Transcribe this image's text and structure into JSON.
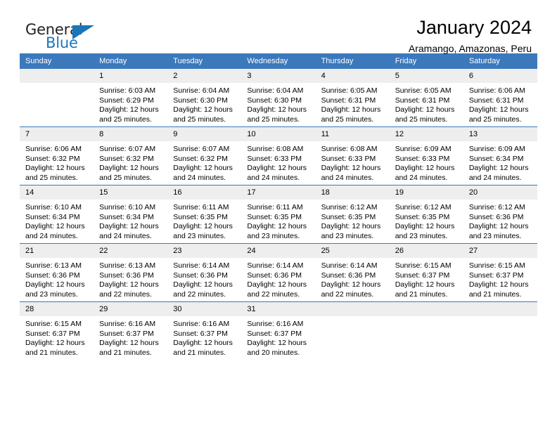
{
  "brand": {
    "name_top": "General",
    "name_bottom": "Blue",
    "triangle_color": "#1b75bb",
    "text_color": "#231f20"
  },
  "header": {
    "title": "January 2024",
    "subtitle": "Aramango, Amazonas, Peru"
  },
  "theme": {
    "header_bg": "#3b79bc",
    "header_text": "#ffffff",
    "daynum_bg": "#eeeeee",
    "cell_bg": "#ffffff",
    "grid_line": "#3b79bc"
  },
  "weekdays": [
    "Sunday",
    "Monday",
    "Tuesday",
    "Wednesday",
    "Thursday",
    "Friday",
    "Saturday"
  ],
  "weeks": [
    [
      {
        "day": "",
        "sunrise": "",
        "sunset": "",
        "daylight_line1": "",
        "daylight_line2": ""
      },
      {
        "day": "1",
        "sunrise": "Sunrise: 6:03 AM",
        "sunset": "Sunset: 6:29 PM",
        "daylight_line1": "Daylight: 12 hours",
        "daylight_line2": "and 25 minutes."
      },
      {
        "day": "2",
        "sunrise": "Sunrise: 6:04 AM",
        "sunset": "Sunset: 6:30 PM",
        "daylight_line1": "Daylight: 12 hours",
        "daylight_line2": "and 25 minutes."
      },
      {
        "day": "3",
        "sunrise": "Sunrise: 6:04 AM",
        "sunset": "Sunset: 6:30 PM",
        "daylight_line1": "Daylight: 12 hours",
        "daylight_line2": "and 25 minutes."
      },
      {
        "day": "4",
        "sunrise": "Sunrise: 6:05 AM",
        "sunset": "Sunset: 6:31 PM",
        "daylight_line1": "Daylight: 12 hours",
        "daylight_line2": "and 25 minutes."
      },
      {
        "day": "5",
        "sunrise": "Sunrise: 6:05 AM",
        "sunset": "Sunset: 6:31 PM",
        "daylight_line1": "Daylight: 12 hours",
        "daylight_line2": "and 25 minutes."
      },
      {
        "day": "6",
        "sunrise": "Sunrise: 6:06 AM",
        "sunset": "Sunset: 6:31 PM",
        "daylight_line1": "Daylight: 12 hours",
        "daylight_line2": "and 25 minutes."
      }
    ],
    [
      {
        "day": "7",
        "sunrise": "Sunrise: 6:06 AM",
        "sunset": "Sunset: 6:32 PM",
        "daylight_line1": "Daylight: 12 hours",
        "daylight_line2": "and 25 minutes."
      },
      {
        "day": "8",
        "sunrise": "Sunrise: 6:07 AM",
        "sunset": "Sunset: 6:32 PM",
        "daylight_line1": "Daylight: 12 hours",
        "daylight_line2": "and 25 minutes."
      },
      {
        "day": "9",
        "sunrise": "Sunrise: 6:07 AM",
        "sunset": "Sunset: 6:32 PM",
        "daylight_line1": "Daylight: 12 hours",
        "daylight_line2": "and 24 minutes."
      },
      {
        "day": "10",
        "sunrise": "Sunrise: 6:08 AM",
        "sunset": "Sunset: 6:33 PM",
        "daylight_line1": "Daylight: 12 hours",
        "daylight_line2": "and 24 minutes."
      },
      {
        "day": "11",
        "sunrise": "Sunrise: 6:08 AM",
        "sunset": "Sunset: 6:33 PM",
        "daylight_line1": "Daylight: 12 hours",
        "daylight_line2": "and 24 minutes."
      },
      {
        "day": "12",
        "sunrise": "Sunrise: 6:09 AM",
        "sunset": "Sunset: 6:33 PM",
        "daylight_line1": "Daylight: 12 hours",
        "daylight_line2": "and 24 minutes."
      },
      {
        "day": "13",
        "sunrise": "Sunrise: 6:09 AM",
        "sunset": "Sunset: 6:34 PM",
        "daylight_line1": "Daylight: 12 hours",
        "daylight_line2": "and 24 minutes."
      }
    ],
    [
      {
        "day": "14",
        "sunrise": "Sunrise: 6:10 AM",
        "sunset": "Sunset: 6:34 PM",
        "daylight_line1": "Daylight: 12 hours",
        "daylight_line2": "and 24 minutes."
      },
      {
        "day": "15",
        "sunrise": "Sunrise: 6:10 AM",
        "sunset": "Sunset: 6:34 PM",
        "daylight_line1": "Daylight: 12 hours",
        "daylight_line2": "and 24 minutes."
      },
      {
        "day": "16",
        "sunrise": "Sunrise: 6:11 AM",
        "sunset": "Sunset: 6:35 PM",
        "daylight_line1": "Daylight: 12 hours",
        "daylight_line2": "and 23 minutes."
      },
      {
        "day": "17",
        "sunrise": "Sunrise: 6:11 AM",
        "sunset": "Sunset: 6:35 PM",
        "daylight_line1": "Daylight: 12 hours",
        "daylight_line2": "and 23 minutes."
      },
      {
        "day": "18",
        "sunrise": "Sunrise: 6:12 AM",
        "sunset": "Sunset: 6:35 PM",
        "daylight_line1": "Daylight: 12 hours",
        "daylight_line2": "and 23 minutes."
      },
      {
        "day": "19",
        "sunrise": "Sunrise: 6:12 AM",
        "sunset": "Sunset: 6:35 PM",
        "daylight_line1": "Daylight: 12 hours",
        "daylight_line2": "and 23 minutes."
      },
      {
        "day": "20",
        "sunrise": "Sunrise: 6:12 AM",
        "sunset": "Sunset: 6:36 PM",
        "daylight_line1": "Daylight: 12 hours",
        "daylight_line2": "and 23 minutes."
      }
    ],
    [
      {
        "day": "21",
        "sunrise": "Sunrise: 6:13 AM",
        "sunset": "Sunset: 6:36 PM",
        "daylight_line1": "Daylight: 12 hours",
        "daylight_line2": "and 23 minutes."
      },
      {
        "day": "22",
        "sunrise": "Sunrise: 6:13 AM",
        "sunset": "Sunset: 6:36 PM",
        "daylight_line1": "Daylight: 12 hours",
        "daylight_line2": "and 22 minutes."
      },
      {
        "day": "23",
        "sunrise": "Sunrise: 6:14 AM",
        "sunset": "Sunset: 6:36 PM",
        "daylight_line1": "Daylight: 12 hours",
        "daylight_line2": "and 22 minutes."
      },
      {
        "day": "24",
        "sunrise": "Sunrise: 6:14 AM",
        "sunset": "Sunset: 6:36 PM",
        "daylight_line1": "Daylight: 12 hours",
        "daylight_line2": "and 22 minutes."
      },
      {
        "day": "25",
        "sunrise": "Sunrise: 6:14 AM",
        "sunset": "Sunset: 6:36 PM",
        "daylight_line1": "Daylight: 12 hours",
        "daylight_line2": "and 22 minutes."
      },
      {
        "day": "26",
        "sunrise": "Sunrise: 6:15 AM",
        "sunset": "Sunset: 6:37 PM",
        "daylight_line1": "Daylight: 12 hours",
        "daylight_line2": "and 21 minutes."
      },
      {
        "day": "27",
        "sunrise": "Sunrise: 6:15 AM",
        "sunset": "Sunset: 6:37 PM",
        "daylight_line1": "Daylight: 12 hours",
        "daylight_line2": "and 21 minutes."
      }
    ],
    [
      {
        "day": "28",
        "sunrise": "Sunrise: 6:15 AM",
        "sunset": "Sunset: 6:37 PM",
        "daylight_line1": "Daylight: 12 hours",
        "daylight_line2": "and 21 minutes."
      },
      {
        "day": "29",
        "sunrise": "Sunrise: 6:16 AM",
        "sunset": "Sunset: 6:37 PM",
        "daylight_line1": "Daylight: 12 hours",
        "daylight_line2": "and 21 minutes."
      },
      {
        "day": "30",
        "sunrise": "Sunrise: 6:16 AM",
        "sunset": "Sunset: 6:37 PM",
        "daylight_line1": "Daylight: 12 hours",
        "daylight_line2": "and 21 minutes."
      },
      {
        "day": "31",
        "sunrise": "Sunrise: 6:16 AM",
        "sunset": "Sunset: 6:37 PM",
        "daylight_line1": "Daylight: 12 hours",
        "daylight_line2": "and 20 minutes."
      },
      {
        "day": "",
        "sunrise": "",
        "sunset": "",
        "daylight_line1": "",
        "daylight_line2": ""
      },
      {
        "day": "",
        "sunrise": "",
        "sunset": "",
        "daylight_line1": "",
        "daylight_line2": ""
      },
      {
        "day": "",
        "sunrise": "",
        "sunset": "",
        "daylight_line1": "",
        "daylight_line2": ""
      }
    ]
  ]
}
